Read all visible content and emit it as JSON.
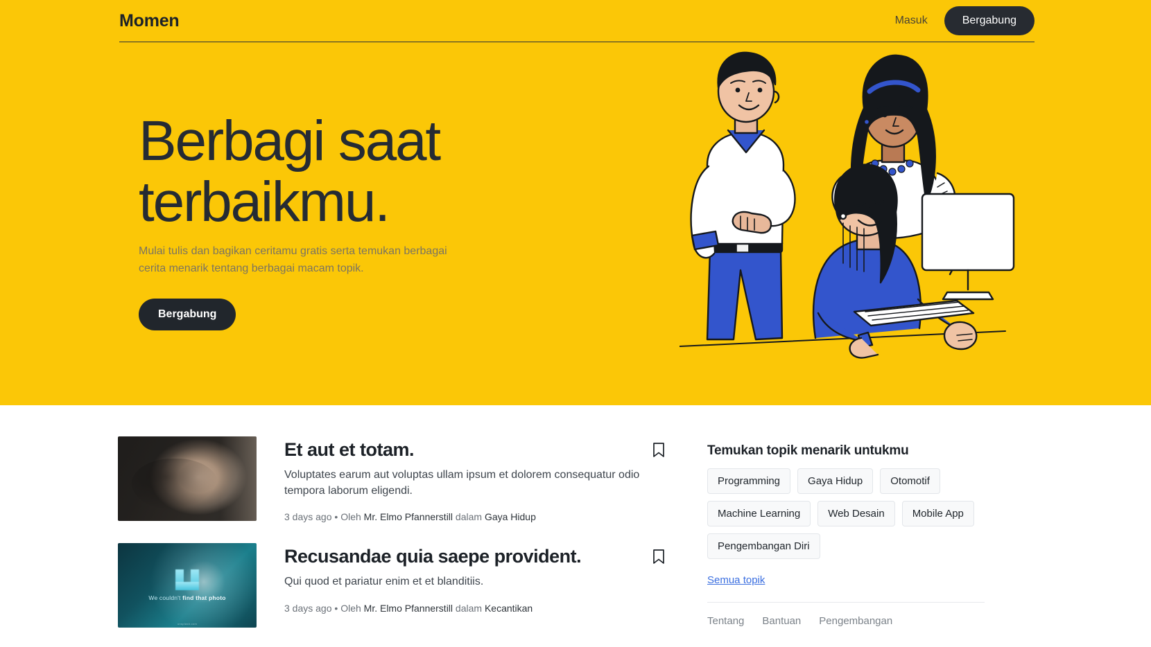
{
  "nav": {
    "brand": "Momen",
    "login_label": "Masuk",
    "join_label": "Bergabung"
  },
  "hero": {
    "title_line1": "Berbagi saat",
    "title_line2": "terbaikmu.",
    "subtitle": "Mulai tulis dan bagikan ceritamu gratis serta temukan berbagai cerita menarik tentang berbagai macam topik.",
    "cta_label": "Bergabung",
    "background_color": "#fbc707",
    "illustration_name": "team-at-computer-illustration"
  },
  "feed": {
    "articles": [
      {
        "title": "Et aut et totam.",
        "excerpt": "Voluptates earum aut voluptas ullam ipsum et dolorem consequatur odio tempora laborum eligendi.",
        "time": "3 days ago",
        "separator": "•",
        "by_prefix": "Oleh",
        "author": "Mr. Elmo Pfannerstill",
        "in_prefix": "dalam",
        "category": "Gaya Hidup",
        "thumbnail": "portrait-photo"
      },
      {
        "title": "Recusandae quia saepe provident.",
        "excerpt": "Qui quod et pariatur enim et et blanditiis.",
        "time": "3 days ago",
        "separator": "•",
        "by_prefix": "Oleh",
        "author": "Mr. Elmo Pfannerstill",
        "in_prefix": "dalam",
        "category": "Kecantikan",
        "thumbnail": "missing-photo-placeholder",
        "placeholder_text_1": "We couldn't",
        "placeholder_text_2": "find that photo",
        "placeholder_credit": "unsplash.com"
      }
    ]
  },
  "sidebar": {
    "topics_title": "Temukan topik menarik untukmu",
    "topics": [
      "Programming",
      "Gaya Hidup",
      "Otomotif",
      "Machine Learning",
      "Web Desain",
      "Mobile App",
      "Pengembangan Diri"
    ],
    "all_topics_label": "Semua topik",
    "footer_links": [
      "Tentang",
      "Bantuan",
      "Pengembangan"
    ],
    "link_color": "#3b6fe0"
  }
}
